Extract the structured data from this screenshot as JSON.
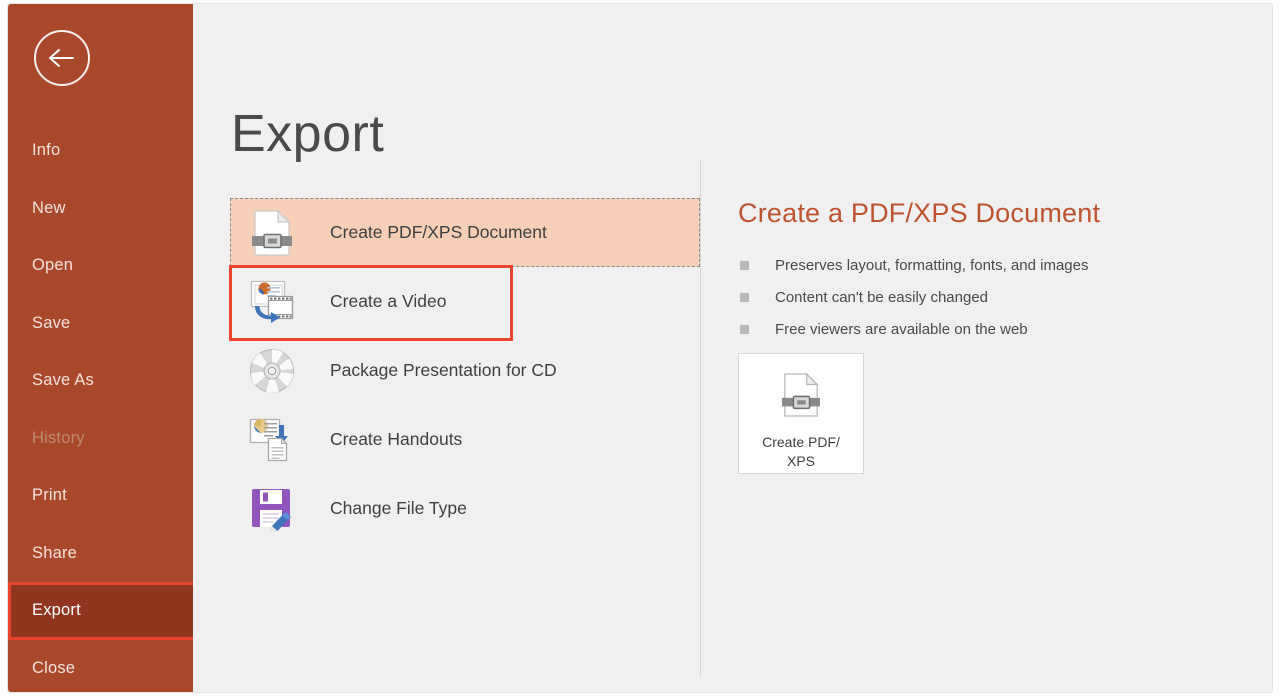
{
  "sidebar": {
    "back_button": {
      "icon": "back-arrow-icon",
      "label": "Back"
    },
    "accent_color": "#a9482c",
    "active_color": "#8f3520",
    "highlight_color": "#e8452c",
    "items": [
      {
        "label": "Info",
        "state": "normal"
      },
      {
        "label": "New",
        "state": "normal"
      },
      {
        "label": "Open",
        "state": "normal"
      },
      {
        "label": "Save",
        "state": "normal"
      },
      {
        "label": "Save As",
        "state": "normal"
      },
      {
        "label": "History",
        "state": "disabled"
      },
      {
        "label": "Print",
        "state": "normal"
      },
      {
        "label": "Share",
        "state": "normal"
      },
      {
        "label": "Export",
        "state": "active-highlighted"
      },
      {
        "label": "Close",
        "state": "normal"
      }
    ]
  },
  "main": {
    "title": "Export",
    "options": [
      {
        "label": "Create PDF/XPS Document",
        "icon": "pdf-document-icon",
        "state": "selected"
      },
      {
        "label": "Create a Video",
        "icon": "video-icon",
        "state": "highlighted"
      },
      {
        "label": "Package Presentation for CD",
        "icon": "cd-disc-icon",
        "state": "normal"
      },
      {
        "label": "Create Handouts",
        "icon": "handouts-icon",
        "state": "normal"
      },
      {
        "label": "Change File Type",
        "icon": "file-type-icon",
        "state": "normal"
      }
    ]
  },
  "detail": {
    "title": "Create a PDF/XPS Document",
    "title_color": "#c0532f",
    "bullets": [
      "Preserves layout, formatting, fonts, and images",
      "Content can't be easily changed",
      "Free viewers are available on the web"
    ],
    "action_button": {
      "line1": "Create PDF/",
      "line2": "XPS",
      "icon": "pdf-document-icon"
    }
  }
}
